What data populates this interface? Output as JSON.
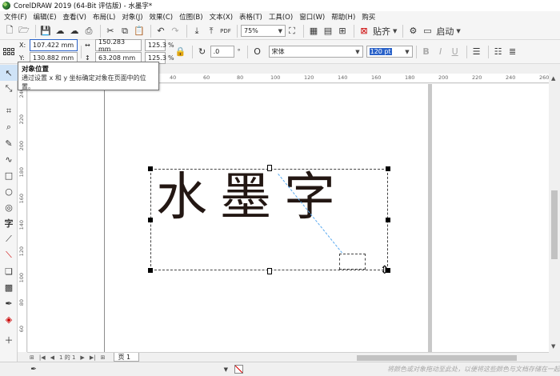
{
  "window": {
    "title": "CorelDRAW 2019 (64-Bit 评估版) - 水墨字*"
  },
  "menu": [
    "文件(F)",
    "编辑(E)",
    "查看(V)",
    "布局(L)",
    "对象(J)",
    "效果(C)",
    "位图(B)",
    "文本(X)",
    "表格(T)",
    "工具(O)",
    "窗口(W)",
    "帮助(H)",
    "购买"
  ],
  "toolbar": {
    "zoom": "75%",
    "snap_label": "贴齐",
    "launch_label": "启动",
    "pdf_label": "PDF"
  },
  "properties": {
    "x_label": "X:",
    "y_label": "Y:",
    "x": "107.422 mm",
    "y": "130.882 mm",
    "width": "150.283 mm",
    "height": "63.208 mm",
    "scale_x": "125.3",
    "scale_y": "125.3",
    "pct": "%",
    "rotation": ".0",
    "rotation_unit": "°",
    "font": "宋体",
    "font_size": "120 pt",
    "bold": "B",
    "italic": "I",
    "underline": "U"
  },
  "ruler": {
    "h_labels": [
      "40",
      "20",
      "0",
      "20",
      "40",
      "60",
      "80",
      "100",
      "120",
      "140",
      "160",
      "180",
      "200",
      "220",
      "240",
      "260"
    ],
    "v_labels": [
      "240",
      "220",
      "200",
      "180",
      "160",
      "140",
      "120",
      "100",
      "80",
      "60"
    ]
  },
  "canvas": {
    "text": "水墨字",
    "text_color": "#231713"
  },
  "page_nav": {
    "count": "1",
    "of": "的",
    "total": "1",
    "tab": "页 1"
  },
  "statusbar": {
    "hint": "将颜色或对象拖动至此处，以便将这些颜色与文档存储在一起"
  },
  "tooltip": {
    "title": "对象位置",
    "body": "通过设置 x 和 y 坐标确定对象在页面中的位置。"
  },
  "colors": {
    "accent": "#2a62c9",
    "guide": "#5aaaf0"
  }
}
